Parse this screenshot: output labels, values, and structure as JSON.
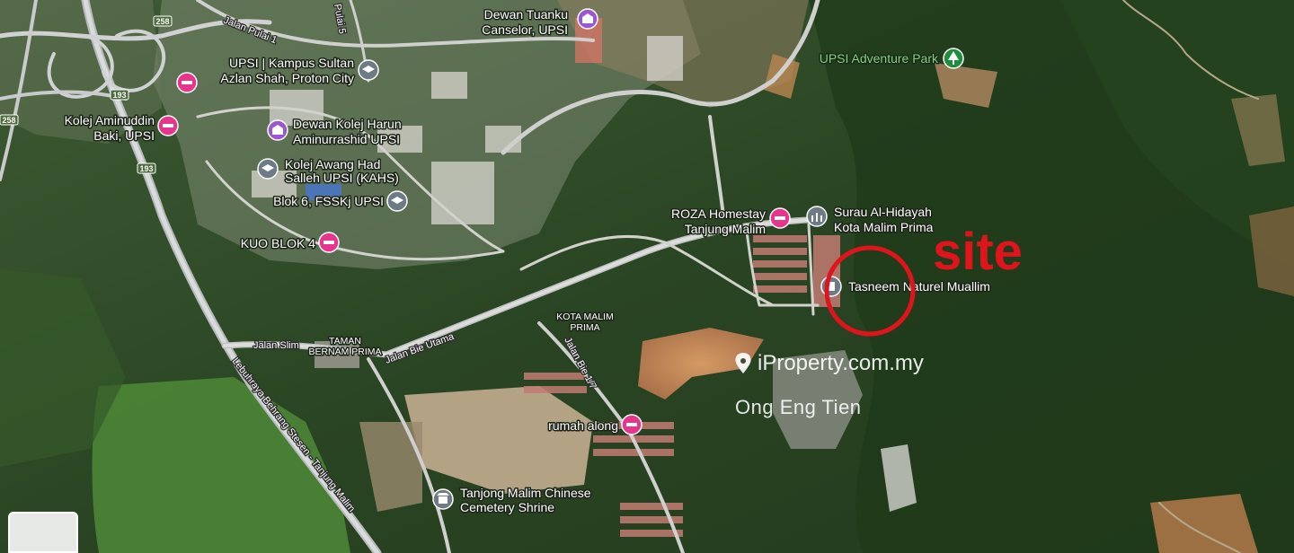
{
  "colors": {
    "forest": "#2c4a23",
    "forest_dark": "#1d3418",
    "grass": "#5a8a3e",
    "clearing": "#b7a389",
    "earth_orange": "#c98a54",
    "road": "#c9c9c9",
    "highway": "#b9bcbf",
    "site_circle": "#e0141c",
    "lodging_pin": "#e8358c",
    "civic_pin": "#9c56cf",
    "school_pin": "#6e7b85",
    "park_pin": "#1e8e3e"
  },
  "site_label": "site",
  "watermark": {
    "brand": "iProperty.com.my",
    "agent": "Ong Eng Tien"
  },
  "roads": {
    "jalan_pulai": "Jalan Pulai 1",
    "jalan_pulai_5": "Pulai 5",
    "jalan_slim": "Jalan Slim",
    "jalan_bie_utama": "Jalan Bie Utama",
    "jalan_bie_17": "Jalan Bie 1/7",
    "highway": "Lebuhraya Behrang Stesen - Tanjung Malim"
  },
  "shields": {
    "r258a": "258",
    "r258b": "258",
    "r193a": "193",
    "r193b": "193"
  },
  "areas": {
    "taman_bernam": [
      "TAMAN",
      "BERNAM PRIMA"
    ],
    "kota_malim": [
      "KOTA MALIM",
      "PRIMA"
    ]
  },
  "places": {
    "dewan_tuanku": {
      "lines": [
        "Dewan Tuanku",
        "Canselor, UPSI"
      ],
      "icon": "civic-icon"
    },
    "upsi_adventure": {
      "lines": [
        "UPSI Adventure Park"
      ],
      "icon": "tree-icon"
    },
    "upsi_kampus": {
      "lines": [
        "UPSI | Kampus Sultan",
        "Azlan Shah, Proton City"
      ],
      "icon": "school-icon"
    },
    "kolej_aminuddin": {
      "lines": [
        "Kolej Aminuddin",
        "Baki, UPSI"
      ],
      "icon": "bed-icon"
    },
    "dewan_kolej": {
      "lines": [
        "Dewan Kolej Harun",
        "Aminurrashid UPSI"
      ],
      "icon": "civic-icon"
    },
    "kolej_awang": {
      "lines": [
        "Kolej Awang Had",
        "Salleh UPSI (KAHS)"
      ],
      "icon": "school-icon"
    },
    "blok6": {
      "lines": [
        "Blok 6, FSSKj UPSI"
      ],
      "icon": "school-icon"
    },
    "kuo_blok": {
      "lines": [
        "KUO BLOK 4"
      ],
      "icon": "bed-icon"
    },
    "roza": {
      "lines": [
        "ROZA Homestay",
        "Tanjung Malim"
      ],
      "icon": "bed-icon"
    },
    "surau": {
      "lines": [
        "Surau Al-Hidayah",
        "Kota Malim Prima"
      ],
      "icon": "mosque-icon"
    },
    "tasneem": {
      "lines": [
        "Tasneem Naturel Muallim"
      ],
      "icon": "building-icon"
    },
    "rumah_along": {
      "lines": [
        "rumah along"
      ],
      "icon": "bed-icon"
    },
    "tanjong_shrine": {
      "lines": [
        "Tanjong Malim Chinese",
        "Cemetery Shrine"
      ],
      "icon": "shrine-icon"
    }
  }
}
